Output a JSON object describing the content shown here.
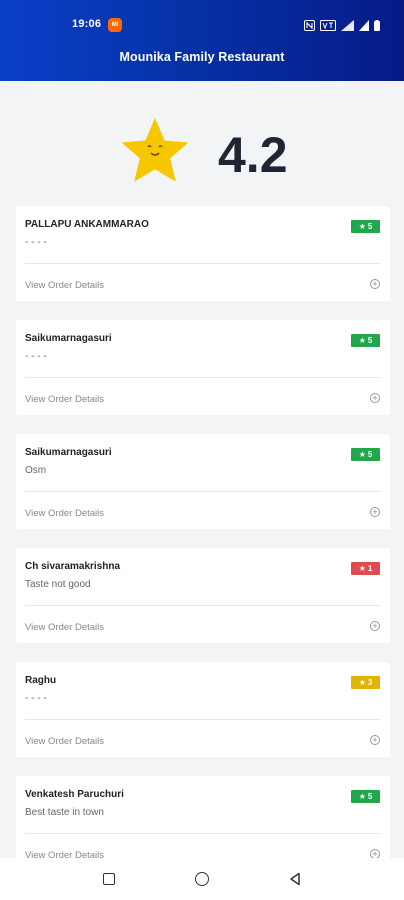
{
  "status_bar": {
    "time": "19:06",
    "app_badge": "MI",
    "icons": [
      "nfc-icon",
      "volte-icon",
      "wifi-icon",
      "signal-icon",
      "battery-icon"
    ]
  },
  "header": {
    "title": "Mounika Family Restaurant"
  },
  "rating": {
    "value": "4.2"
  },
  "colors": {
    "header_start": "#0a3fc8",
    "header_end": "#061a86",
    "star": "#f6c700",
    "green": "#21a64b",
    "red": "#e04b52",
    "yellow": "#e0b400"
  },
  "reviews": [
    {
      "name": "PALLAPU ANKAMMARAO",
      "comment": "- - - -",
      "rating": "5",
      "details": "View Order Details",
      "badge_color": "#21a64b"
    },
    {
      "name": "Saikumarnagasuri",
      "comment": "- - - -",
      "rating": "5",
      "details": "View Order Details",
      "badge_color": "#21a64b"
    },
    {
      "name": "Saikumarnagasuri",
      "comment": "Osm",
      "rating": "5",
      "details": "View Order Details",
      "badge_color": "#21a64b"
    },
    {
      "name": "Ch sivaramakrishna",
      "comment": "Taste not good",
      "rating": "1",
      "details": "View Order Details",
      "badge_color": "#e04b52"
    },
    {
      "name": "Raghu",
      "comment": "- - - -",
      "rating": "3",
      "details": "View Order Details",
      "badge_color": "#e0b400"
    },
    {
      "name": "Venkatesh Paruchuri",
      "comment": "Best taste in town",
      "rating": "5",
      "details": "View Order Details",
      "badge_color": "#21a64b"
    }
  ],
  "navbar": {
    "buttons": [
      "recent-apps",
      "home",
      "back"
    ]
  }
}
